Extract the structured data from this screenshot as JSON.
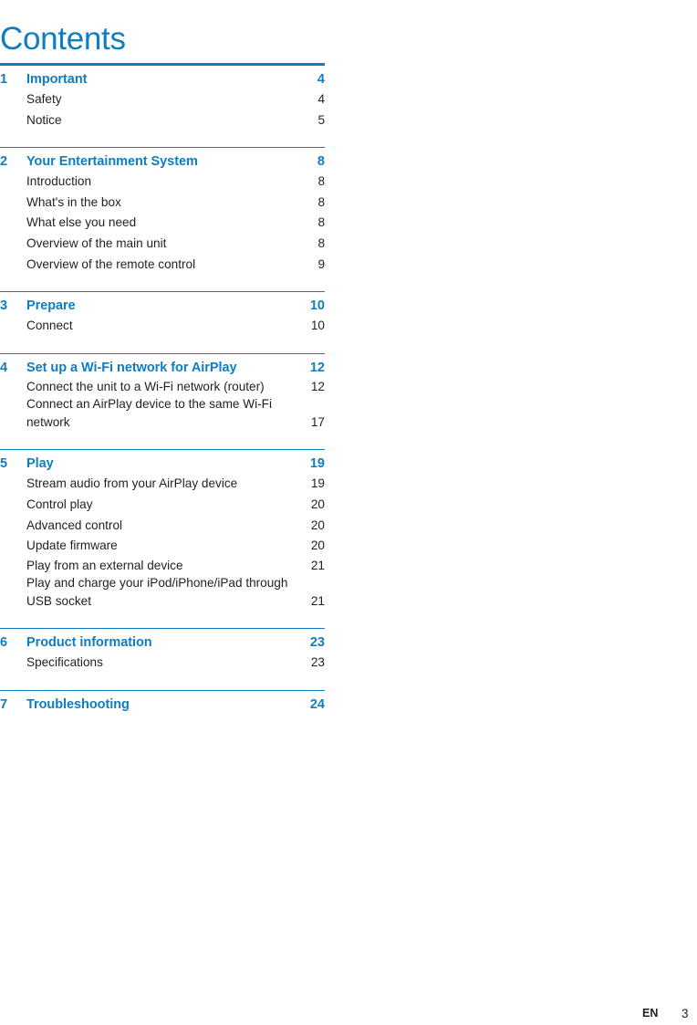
{
  "document": {
    "title": "Contents",
    "accent_color": "#0f7dc2",
    "text_color": "#231f20"
  },
  "footer": {
    "language": "EN",
    "page_number": "3"
  },
  "sections": [
    {
      "number": "1",
      "title": "Important",
      "page": "4",
      "entries": [
        {
          "label": "Safety",
          "page": "4"
        },
        {
          "label": "Notice",
          "page": "5"
        }
      ]
    },
    {
      "number": "2",
      "title": "Your Entertainment System",
      "page": "8",
      "entries": [
        {
          "label": "Introduction",
          "page": "8"
        },
        {
          "label": "What's in the box",
          "page": "8"
        },
        {
          "label": "What else you need",
          "page": "8"
        },
        {
          "label": "Overview of the main unit",
          "page": "8"
        },
        {
          "label": "Overview of the remote control",
          "page": "9"
        }
      ]
    },
    {
      "number": "3",
      "title": "Prepare",
      "page": "10",
      "entries": [
        {
          "label": "Connect",
          "page": "10"
        }
      ]
    },
    {
      "number": "4",
      "title": "Set up a Wi-Fi network for AirPlay",
      "page": "12",
      "entries": [
        {
          "label": "Connect the unit to a Wi-Fi network (router)",
          "page": "12"
        },
        {
          "label": "Connect an AirPlay device to the same Wi-Fi",
          "page": ""
        },
        {
          "label": "network",
          "page": "17"
        }
      ]
    },
    {
      "number": "5",
      "title": "Play",
      "page": "19",
      "entries": [
        {
          "label": "Stream audio from your AirPlay device",
          "page": "19"
        },
        {
          "label": "Control play",
          "page": "20"
        },
        {
          "label": "Advanced control",
          "page": "20"
        },
        {
          "label": "Update firmware",
          "page": "20"
        },
        {
          "label": "Play from an external device",
          "page": "21"
        },
        {
          "label": "Play and charge your iPod/iPhone/iPad through",
          "page": ""
        },
        {
          "label": "USB socket",
          "page": "21"
        }
      ]
    },
    {
      "number": "6",
      "title": "Product information",
      "page": "23",
      "entries": [
        {
          "label": "Specifications",
          "page": "23"
        }
      ]
    },
    {
      "number": "7",
      "title": "Troubleshooting",
      "page": "24",
      "entries": []
    }
  ]
}
